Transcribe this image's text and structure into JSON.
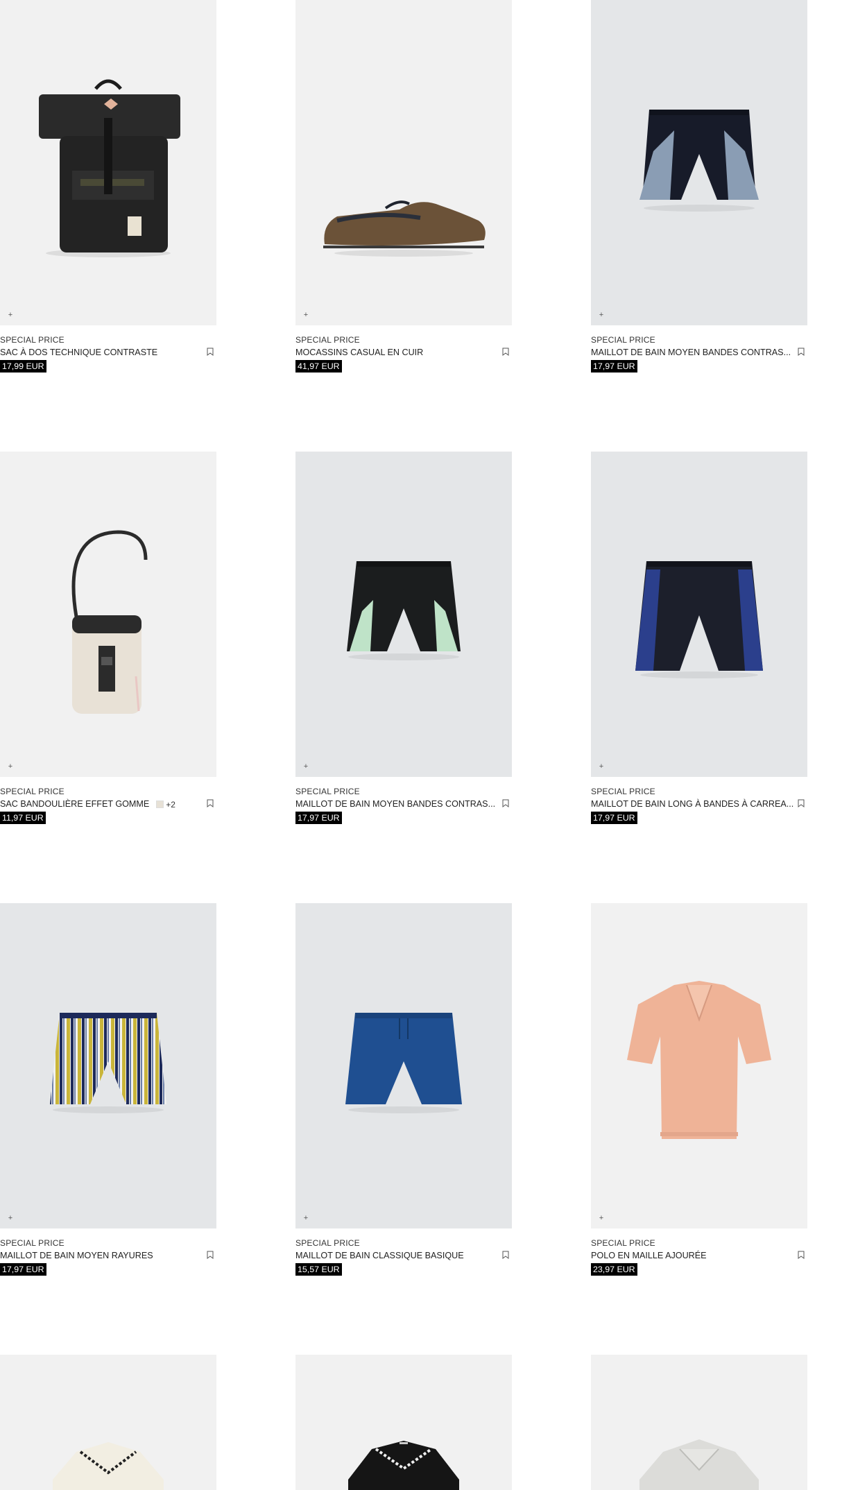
{
  "products": [
    {
      "tag": "SPECIAL PRICE",
      "name": "SAC À DOS TECHNIQUE CONTRASTE",
      "price": "17,99 EUR",
      "image": "black-backpack",
      "bg": "#f1f1f1"
    },
    {
      "tag": "SPECIAL PRICE",
      "name": "MOCASSINS CASUAL EN CUIR",
      "price": "41,97 EUR",
      "image": "brown-loafer",
      "bg": "#f1f1f1"
    },
    {
      "tag": "SPECIAL PRICE",
      "name": "MAILLOT DE BAIN MOYEN BANDES CONTRAS...",
      "price": "17,97 EUR",
      "image": "navy-swim-shorts-blue-panels",
      "bg": "#e4e6e8"
    },
    {
      "tag": "SPECIAL PRICE",
      "name": "SAC BANDOULIÈRE EFFET GOMME",
      "swatch_count": "+2",
      "price": "11,97 EUR",
      "image": "cream-crossbody-bag",
      "bg": "#f1f1f1"
    },
    {
      "tag": "SPECIAL PRICE",
      "name": "MAILLOT DE BAIN MOYEN BANDES CONTRAS...",
      "price": "17,97 EUR",
      "image": "black-swim-shorts-mint-stripes",
      "bg": "#e4e6e8"
    },
    {
      "tag": "SPECIAL PRICE",
      "name": "MAILLOT DE BAIN LONG À BANDES À CARREA...",
      "price": "17,97 EUR",
      "image": "black-swim-shorts-blue-check-panels",
      "bg": "#e4e6e8"
    },
    {
      "tag": "SPECIAL PRICE",
      "name": "MAILLOT DE BAIN MOYEN RAYURES",
      "price": "17,97 EUR",
      "image": "striped-swim-shorts",
      "bg": "#e4e6e8"
    },
    {
      "tag": "SPECIAL PRICE",
      "name": "MAILLOT DE BAIN CLASSIQUE BASIQUE",
      "price": "15,57 EUR",
      "image": "blue-swim-shorts",
      "bg": "#e4e6e8"
    },
    {
      "tag": "SPECIAL PRICE",
      "name": "POLO EN MAILLE AJOURÉE",
      "price": "23,97 EUR",
      "image": "peach-knit-polo",
      "bg": "#f1f1f1"
    },
    {
      "image": "cream-shirt-contrast-trim",
      "bg": "#f1f1f1"
    },
    {
      "image": "black-shirt-contrast-trim",
      "bg": "#f1f1f1"
    },
    {
      "image": "grey-polo",
      "bg": "#f1f1f1"
    }
  ],
  "icons": {
    "quick_add": "plus-icon",
    "save": "bookmark-icon"
  }
}
